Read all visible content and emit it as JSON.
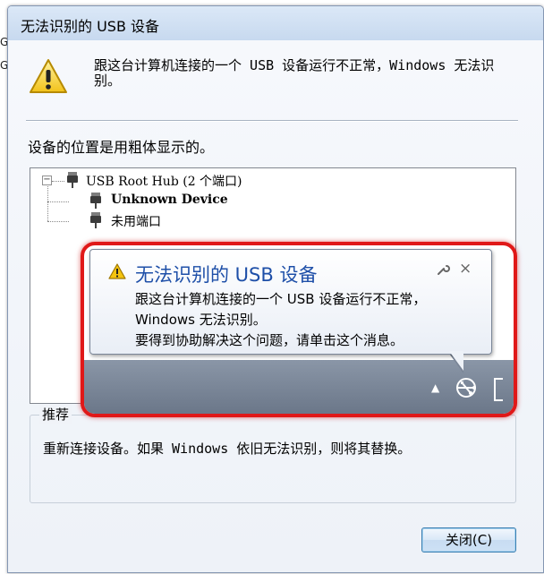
{
  "dialog": {
    "title": "无法识别的 USB 设备",
    "message": "跟这台计算机连接的一个 USB 设备运行不正常，Windows 无法识别。",
    "bold_note": "设备的位置是用粗体显示的。",
    "tree": {
      "root_label": "USB Root Hub (2 个端口)",
      "children": [
        "Unknown Device",
        "未用端口"
      ]
    },
    "recommend": {
      "title": "推荐",
      "text": "重新连接设备。如果 Windows 依旧无法识别，则将其替换。"
    },
    "close_button": "关闭(C)"
  },
  "notification": {
    "title": "无法识别的 USB 设备",
    "line1": "跟这台计算机连接的一个 USB 设备运行不正常，",
    "line2": "Windows 无法识别。",
    "line3": "要得到协助解决这个问题，请单击这个消息。",
    "close_glyph": "×",
    "tray_arrow": "▲"
  },
  "background_chars": [
    "G",
    "G"
  ],
  "colors": {
    "highlight_border": "#e01818",
    "balloon_title": "#1e4fa8",
    "button_border": "#3c7fb1"
  }
}
